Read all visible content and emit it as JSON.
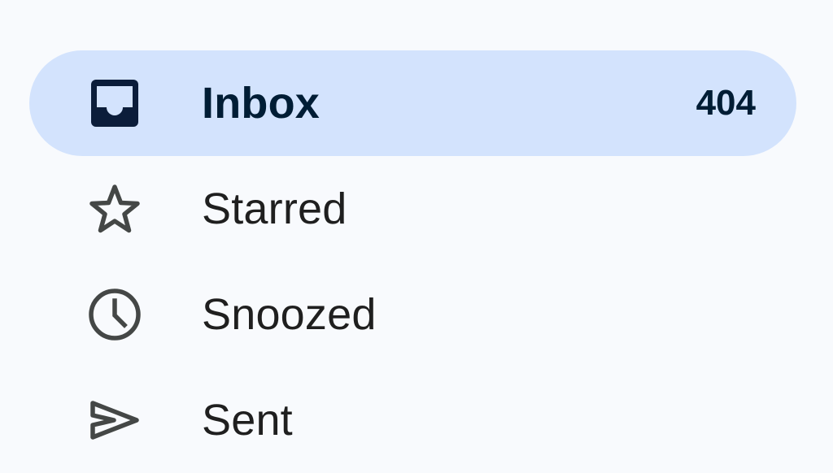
{
  "colors": {
    "background": "#f8fafd",
    "active_background": "#d3e3fd",
    "active_text": "#001d35",
    "text": "#1f1f1f",
    "icon": "#444746"
  },
  "nav": {
    "items": [
      {
        "label": "Inbox",
        "count": "404",
        "icon": "inbox-icon",
        "active": true
      },
      {
        "label": "Starred",
        "count": "",
        "icon": "star-icon",
        "active": false
      },
      {
        "label": "Snoozed",
        "count": "",
        "icon": "clock-icon",
        "active": false
      },
      {
        "label": "Sent",
        "count": "",
        "icon": "send-icon",
        "active": false
      }
    ]
  }
}
